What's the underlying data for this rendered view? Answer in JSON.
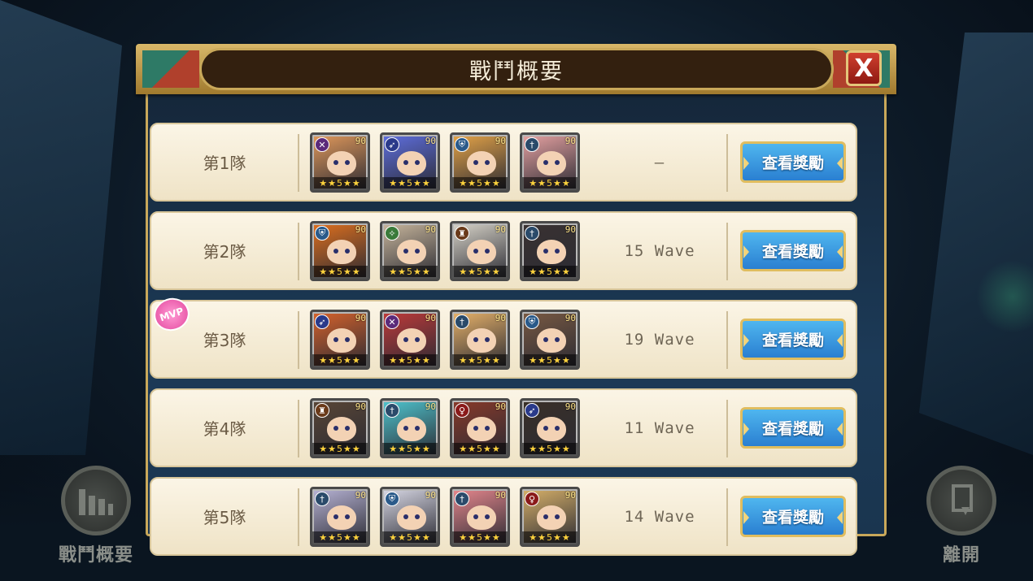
{
  "dialog": {
    "title": "戰鬥概要",
    "close_label": "X"
  },
  "mvp_label": "MVP",
  "reward_label": "查看獎勵",
  "teams": [
    {
      "name": "第1隊",
      "result": "–",
      "members": [
        {
          "role_icon": "sword",
          "level": "90",
          "stars": "★★5★★",
          "color": "#e39a5c"
        },
        {
          "role_icon": "feather",
          "level": "90",
          "stars": "★★5★★",
          "color": "#5f6fe0"
        },
        {
          "role_icon": "shield",
          "level": "90",
          "stars": "★★5★★",
          "color": "#e7a548"
        },
        {
          "role_icon": "cross",
          "level": "90",
          "stars": "★★5★★",
          "color": "#e8a3a3"
        }
      ]
    },
    {
      "name": "第2隊",
      "result": "15 Wave",
      "members": [
        {
          "role_icon": "shield",
          "level": "90",
          "stars": "★★5★★",
          "color": "#e0701e"
        },
        {
          "role_icon": "staff",
          "level": "90",
          "stars": "★★5★★",
          "color": "#c9b79d"
        },
        {
          "role_icon": "helm",
          "level": "90",
          "stars": "★★5★★",
          "color": "#d8d4c9"
        },
        {
          "role_icon": "cross",
          "level": "90",
          "stars": "★★5★★",
          "color": "#3a3232"
        }
      ]
    },
    {
      "name": "第3隊",
      "result": "19 Wave",
      "members": [
        {
          "role_icon": "feather",
          "level": "90",
          "stars": "★★5★★",
          "color": "#d8632c"
        },
        {
          "role_icon": "sword",
          "level": "90",
          "stars": "★★5★★",
          "color": "#c03a3a"
        },
        {
          "role_icon": "cross",
          "level": "90",
          "stars": "★★5★★",
          "color": "#e9b36a"
        },
        {
          "role_icon": "shield",
          "level": "90",
          "stars": "★★5★★",
          "color": "#7a5a43"
        }
      ]
    },
    {
      "name": "第4隊",
      "result": "11 Wave",
      "members": [
        {
          "role_icon": "helm",
          "level": "90",
          "stars": "★★5★★",
          "color": "#5a4636"
        },
        {
          "role_icon": "cross",
          "level": "90",
          "stars": "★★5★★",
          "color": "#4fc6d0"
        },
        {
          "role_icon": "staff-red",
          "level": "90",
          "stars": "★★5★★",
          "color": "#8a3a2a"
        },
        {
          "role_icon": "feather",
          "level": "90",
          "stars": "★★5★★",
          "color": "#3a3028"
        }
      ]
    },
    {
      "name": "第5隊",
      "result": "14 Wave",
      "members": [
        {
          "role_icon": "cross",
          "level": "90",
          "stars": "★★5★★",
          "color": "#b8b4d6"
        },
        {
          "role_icon": "shield",
          "level": "90",
          "stars": "★★5★★",
          "color": "#d9d9e6"
        },
        {
          "role_icon": "cross",
          "level": "90",
          "stars": "★★5★★",
          "color": "#e8888e"
        },
        {
          "role_icon": "staff-red",
          "level": "90",
          "stars": "★★5★★",
          "color": "#d9b26a"
        }
      ]
    }
  ],
  "bottom": {
    "left_label": "戰鬥概要",
    "right_label": "離開"
  }
}
